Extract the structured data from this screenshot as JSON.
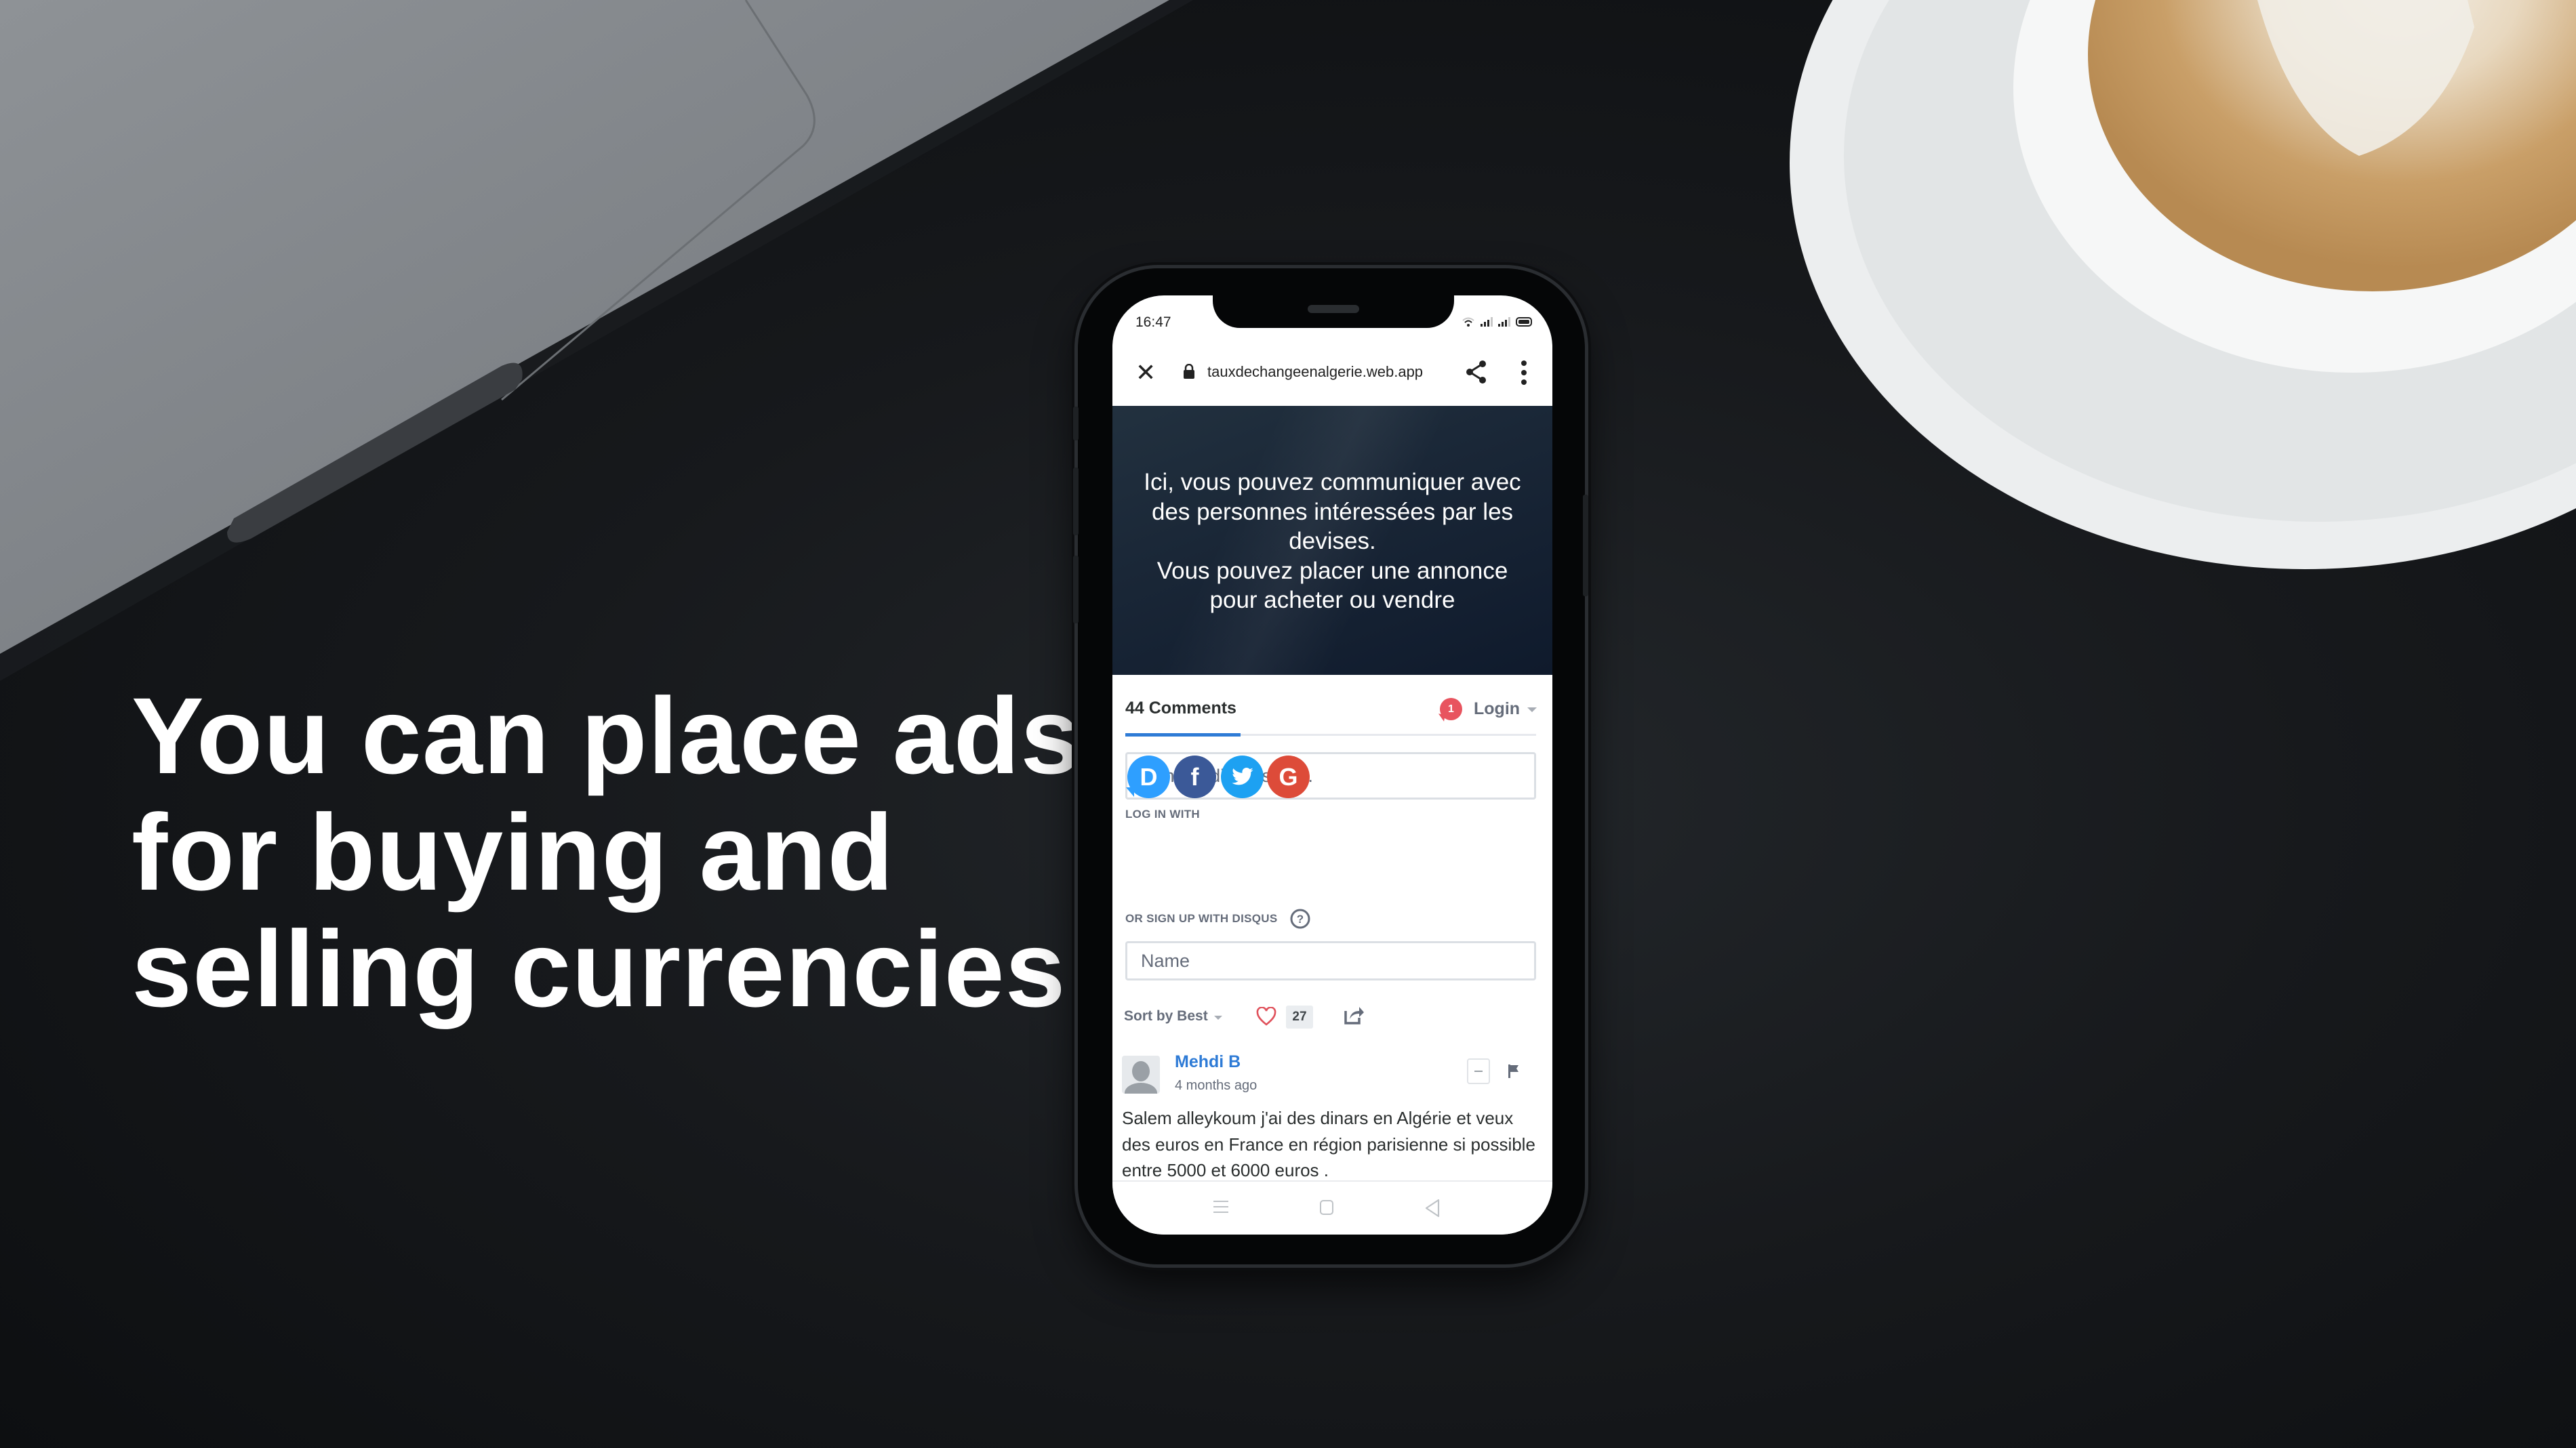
{
  "headline": {
    "lines": [
      "You can place ads",
      "for buying and",
      "selling currencies"
    ]
  },
  "phone": {
    "status_bar": {
      "time": "16:47",
      "icons": [
        "wifi-icon",
        "signal-icon",
        "signal-icon",
        "battery-icon"
      ]
    },
    "browser": {
      "close_icon": "close-icon",
      "lock_icon": "lock-icon",
      "url": "tauxdechangeenalgerie.web.app",
      "share_icon": "share-icon",
      "menu_icon": "more-vertical-icon"
    },
    "banner": {
      "lines": [
        "Ici, vous pouvez communiquer avec",
        "des personnes intéressées par les",
        "devises.",
        "Vous pouvez placer une annonce",
        "pour acheter ou vendre"
      ]
    },
    "disqus": {
      "comments_tab": "44 Comments",
      "notification_count": "1",
      "login_label": "Login",
      "join_placeholder": "Join the discussion…",
      "log_in_with_label": "LOG IN WITH",
      "social_logins": [
        {
          "name": "Disqus",
          "glyph": "D",
          "color": "#2e9fff"
        },
        {
          "name": "Facebook",
          "glyph": "f",
          "color": "#3b5998"
        },
        {
          "name": "Twitter",
          "glyph": "twitter-bird",
          "color": "#1da1f2"
        },
        {
          "name": "Google",
          "glyph": "G",
          "color": "#dd4b39"
        }
      ],
      "sign_up_label": "OR SIGN UP WITH DISQUS",
      "name_placeholder": "Name",
      "sort_label": "Sort by Best",
      "likes_count": "27",
      "comments": [
        {
          "author": "Mehdi B",
          "time_ago": "4 months ago",
          "text": "Salem alleykoum j'ai des dinars en Algérie et veux des euros en France en région parisienne si possible entre 5000 et 6000 euros ."
        }
      ]
    },
    "nav_bar": [
      "menu-icon",
      "home-icon",
      "back-icon"
    ]
  },
  "colors": {
    "accent_blue": "#2e7bd6",
    "badge_red": "#e8545f",
    "banner_dark": "#0f1a2c",
    "text_gray": "#656c7a"
  }
}
